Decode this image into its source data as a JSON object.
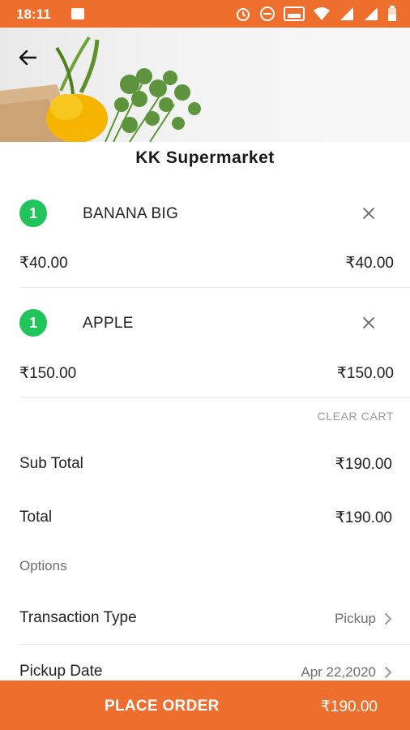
{
  "status_bar": {
    "time": "18:11",
    "color": "#ee6f2d",
    "icons": [
      "image-icon",
      "alarm-icon",
      "dnd-icon",
      "volte-icon",
      "wifi-icon",
      "signal-icon",
      "signal-icon",
      "battery-icon"
    ]
  },
  "header": {
    "back_icon": "arrow-left-icon",
    "store_name": "KK Supermarket"
  },
  "cart": {
    "items": [
      {
        "qty": "1",
        "name": "BANANA BIG",
        "unit_price": "₹40.00",
        "line_total": "₹40.00"
      },
      {
        "qty": "1",
        "name": "APPLE",
        "unit_price": "₹150.00",
        "line_total": "₹150.00"
      }
    ],
    "clear_label": "CLEAR CART"
  },
  "summary": {
    "subtotal_label": "Sub Total",
    "subtotal_value": "₹190.00",
    "total_label": "Total",
    "total_value": "₹190.00"
  },
  "options": {
    "section_label": "Options",
    "transaction_type_label": "Transaction Type",
    "transaction_type_value": "Pickup",
    "pickup_date_label": "Pickup Date",
    "pickup_date_value": "Apr 22,2020"
  },
  "footer": {
    "place_order_label": "PLACE ORDER",
    "amount": "₹190.00"
  },
  "colors": {
    "accent": "#ee6f2d",
    "qty_badge": "#21c45a"
  }
}
